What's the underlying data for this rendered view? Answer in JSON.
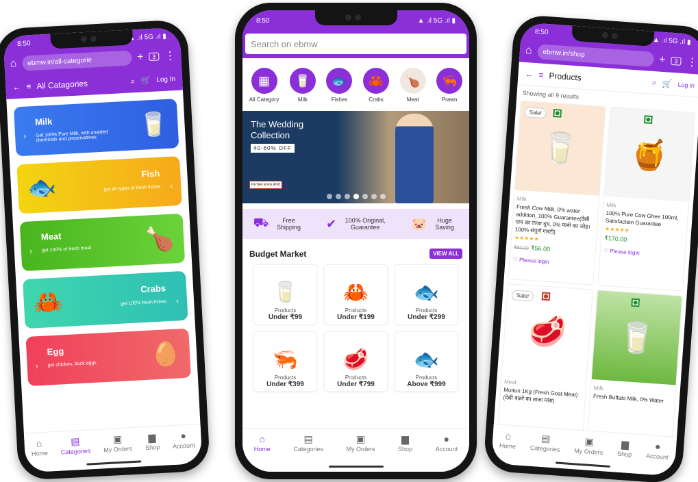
{
  "left": {
    "status_time": "8:50",
    "status_icons": "▲ .ıl 5G .ıl ▮",
    "url": "ebmw.in/all-categorie",
    "tab_count": "3",
    "header_title": "All Catagories",
    "login": "Log In",
    "categories": [
      {
        "name": "Milk",
        "desc": "Get 100% Pure Milk, with unaided chemicals and preservatives.",
        "icon": "milk-icon"
      },
      {
        "name": "Fish",
        "desc": "get all types of fresh fishes",
        "icon": "fish-icon"
      },
      {
        "name": "Meat",
        "desc": "get 100% of fresh meat",
        "icon": "meat-icon"
      },
      {
        "name": "Crabs",
        "desc": "get 100% fresh fishes",
        "icon": "crab-icon"
      },
      {
        "name": "Egg",
        "desc": "get chicken, duck eggs",
        "icon": "egg-icon"
      }
    ],
    "nav": [
      "Home",
      "Categories",
      "My Orders",
      "Shop",
      "Account"
    ]
  },
  "middle": {
    "status_time": "8:50",
    "status_icons": "▲ .ıl 5G .ıl ▮",
    "search_placeholder": "Search on ebmw",
    "circles": [
      "All Category",
      "Milk",
      "Fishes",
      "Crabs",
      "Meat",
      "Prawn"
    ],
    "banner_title": "The Wedding Collection",
    "banner_offer": "40-60% OFF",
    "banner_brand": "PETER ENGLAND",
    "features": [
      "Free Shipping",
      "100% Original, Guarantee",
      "Huge Saving"
    ],
    "budget_title": "Budget Market",
    "view_all": "VIEW ALL",
    "tiles": [
      {
        "label": "Products",
        "price": "Under ₹99"
      },
      {
        "label": "Products",
        "price": "Under ₹199"
      },
      {
        "label": "Products",
        "price": "Under ₹299"
      },
      {
        "label": "Products",
        "price": "Under ₹399"
      },
      {
        "label": "Products",
        "price": "Under ₹799"
      },
      {
        "label": "Products",
        "price": "Above ₹999"
      }
    ],
    "nav": [
      "Home",
      "Categories",
      "My Orders",
      "Shop",
      "Account"
    ]
  },
  "right": {
    "status_time": "8:50",
    "status_icons": "▲ .ıl 5G .ıl ▮",
    "url": "ebmw.in/shop",
    "tab_count": "3",
    "header_title": "Products",
    "login": "Log in",
    "showing": "Showing all 9 results",
    "products": [
      {
        "sale": "Sale!",
        "category": "Milk",
        "name": "Fresh Cow Milk, 0% water addition, 100% Guarantee(देसी गाय का ताजा दूध, 0% पानी का जोड़। 100% संपूर्ण गारंटी)",
        "stars": "★★★★★",
        "old_price": "₹60.00",
        "price": "₹56.00",
        "login": "Please login"
      },
      {
        "sale": "",
        "category": "Milk",
        "name": "100% Pure Cow Ghee 100ml, Satisfaction Guarantee",
        "stars": "★★★★★",
        "old_price": "",
        "price": "₹170.00",
        "login": "Please login"
      },
      {
        "sale": "Sale!",
        "category": "Meat",
        "name": "Mutton 1Kg (Fresh Goat Meat) (देसी बकरे का ताजा मांस)",
        "stars": "",
        "old_price": "",
        "price": "",
        "login": ""
      },
      {
        "sale": "",
        "category": "Milk",
        "name": "Fresh Buffalo Milk, 0% Water",
        "stars": "",
        "old_price": "",
        "price": "",
        "login": ""
      }
    ],
    "nav": [
      "Home",
      "Categories",
      "My Orders",
      "Shop",
      "Account"
    ]
  }
}
